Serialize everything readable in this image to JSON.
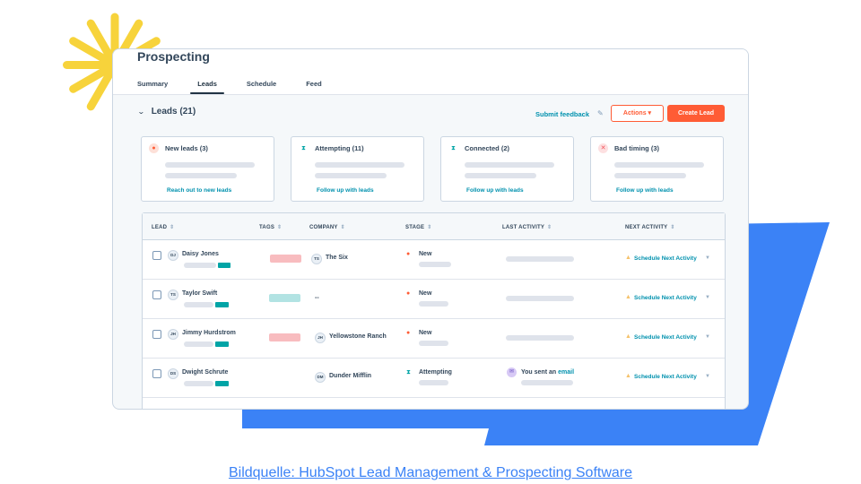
{
  "app": {
    "title": "Prospecting",
    "tabs": [
      {
        "label": "Summary",
        "active": false
      },
      {
        "label": "Leads",
        "active": true
      },
      {
        "label": "Schedule",
        "active": false
      },
      {
        "label": "Feed",
        "active": false
      }
    ]
  },
  "section": {
    "title": "Leads (21)",
    "feedback_label": "Submit feedback",
    "actions_label": "Actions ▾",
    "create_label": "Create Lead"
  },
  "categories": [
    {
      "title": "New leads (3)",
      "icon": "person-icon",
      "color": "#ff5c35",
      "link": "Reach out to new leads"
    },
    {
      "title": "Attempting (11)",
      "icon": "hourglass-icon",
      "color": "#00a4a6",
      "link": "Follow up with leads"
    },
    {
      "title": "Connected (2)",
      "icon": "hourglass-icon",
      "color": "#00a4a6",
      "link": "Follow up with leads"
    },
    {
      "title": "Bad timing (3)",
      "icon": "x-icon",
      "color": "#f2545b",
      "link": "Follow up with leads"
    }
  ],
  "table": {
    "columns": [
      "LEAD",
      "TAGS",
      "COMPANY",
      "STAGE",
      "LAST ACTIVITY",
      "NEXT ACTIVITY"
    ],
    "rows": [
      {
        "initials": "DJ",
        "name": "Daisy Jones",
        "tag_color": "#f8bcbf",
        "company_initials": "TS",
        "company": "The Six",
        "stage": "New",
        "next": "Schedule Next Activity"
      },
      {
        "initials": "TS",
        "name": "Taylor Swift",
        "tag_color": "#b2e3e3",
        "company_initials": "",
        "company": "--",
        "stage": "New",
        "next": "Schedule Next Activity"
      },
      {
        "initials": "JH",
        "name": "Jimmy Hurdstrom",
        "tag_color": "#f8bcbf",
        "company_initials": "JH",
        "company": "Yellowstone Ranch",
        "stage": "New",
        "next": "Schedule Next Activity"
      },
      {
        "initials": "DS",
        "name": "Dwight Schrute",
        "tag_color": "",
        "company_initials": "DM",
        "company": "Dunder Mifflin",
        "stage": "Attempting",
        "activity_prefix": "You sent an ",
        "activity_link": "email",
        "next": "Schedule Next Activity"
      }
    ]
  },
  "caption": "Bildquelle: HubSpot Lead Management & Prospecting Software",
  "colors": {
    "accent": "#ff5c35",
    "link": "#0091ae",
    "blue_shape": "#3b82f6",
    "burst": "#f7d33b"
  }
}
